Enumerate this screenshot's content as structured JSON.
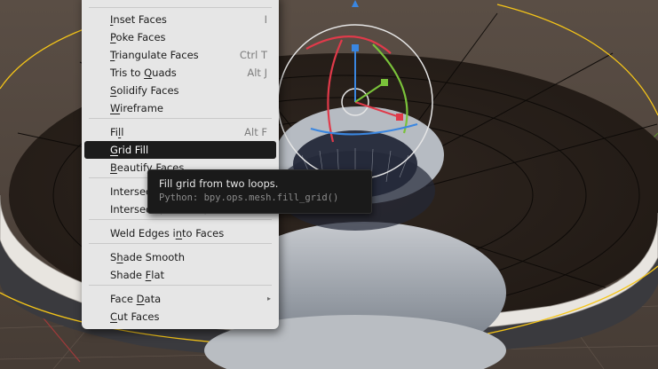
{
  "menu": {
    "items": [
      {
        "label": "Inset Faces",
        "ul": "I",
        "shortcut": "I"
      },
      {
        "label": "Poke Faces",
        "ul": "P",
        "shortcut": ""
      },
      {
        "label": "Triangulate Faces",
        "ul": "T",
        "shortcut": "Ctrl T"
      },
      {
        "label": "Tris to Quads",
        "ul": "Q",
        "shortcut": "Alt J"
      },
      {
        "label": "Solidify Faces",
        "ul": "S",
        "shortcut": ""
      },
      {
        "label": "Wireframe",
        "ul": "W",
        "shortcut": ""
      },
      {
        "label": "Fill",
        "ul": "l",
        "shortcut": "Alt F"
      },
      {
        "label": "Grid Fill",
        "ul": "G",
        "shortcut": ""
      },
      {
        "label": "Beautify Faces",
        "ul": "B",
        "shortcut": ""
      },
      {
        "label": "Intersect (Knife)",
        "ul": "",
        "shortcut": ""
      },
      {
        "label": "Intersect (Boolean)",
        "ul": "",
        "shortcut": ""
      },
      {
        "label": "Weld Edges into Faces",
        "ul": "n",
        "shortcut": ""
      },
      {
        "label": "Shade Smooth",
        "ul": "h",
        "shortcut": ""
      },
      {
        "label": "Shade Flat",
        "ul": "F",
        "shortcut": ""
      },
      {
        "label": "Face Data",
        "ul": "D",
        "shortcut": ""
      },
      {
        "label": "Cut Faces",
        "ul": "C",
        "shortcut": ""
      }
    ],
    "active_label": "Grid Fill",
    "submenu_arrow": "▸"
  },
  "tooltip": {
    "title": "Fill grid from two loops.",
    "python": "Python: bpy.ops.mesh.fill_grid()"
  },
  "colors": {
    "menu_bg": "#e6e6e6",
    "highlight_bg": "#1c1c1c",
    "tooltip_bg": "#1a1a1a",
    "selection_outline": "#f5c518",
    "gizmo_x": "#e03a4a",
    "gizmo_y": "#7ac23a",
    "gizmo_z": "#3a86e0"
  }
}
